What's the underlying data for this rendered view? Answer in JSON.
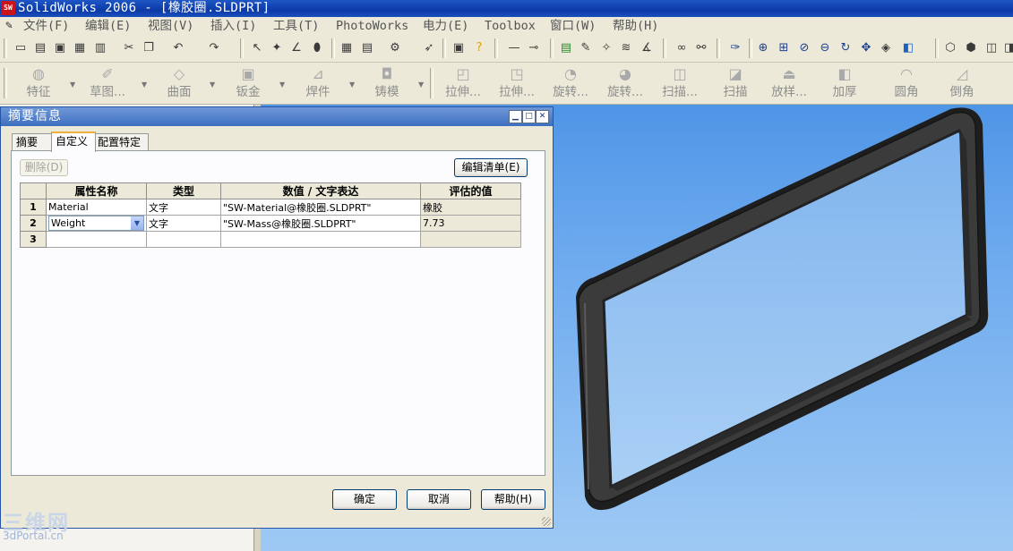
{
  "window": {
    "title": "SolidWorks 2006 - [橡胶圈.SLDPRT]",
    "app_icon": "solidworks-logo-icon"
  },
  "menu": {
    "items": [
      "文件(F)",
      "编辑(E)",
      "视图(V)",
      "插入(I)",
      "工具(T)",
      "PhotoWorks",
      "电力(E)",
      "Toolbox",
      "窗口(W)",
      "帮助(H)"
    ]
  },
  "command_manager": {
    "items": [
      "特征",
      "草图...",
      "曲面",
      "钣金",
      "焊件",
      "铸模",
      "拉伸...",
      "拉伸...",
      "旋转...",
      "旋转...",
      "扫描...",
      "扫描",
      "放样...",
      "加厚",
      "圆角",
      "倒角"
    ]
  },
  "dialog": {
    "title": "摘要信息",
    "tabs": [
      "摘要",
      "自定义",
      "配置特定"
    ],
    "active_tab": "自定义",
    "delete_button": "删除(D)",
    "edit_list_button": "编辑清单(E)",
    "table": {
      "headers": [
        "属性名称",
        "类型",
        "数值 / 文字表达",
        "评估的值"
      ],
      "rows": [
        {
          "num": "1",
          "name": "Material",
          "type": "文字",
          "expression": "\"SW-Material@橡胶圈.SLDPRT\"",
          "value": "橡胶"
        },
        {
          "num": "2",
          "name": "Weight",
          "type": "文字",
          "expression": "\"SW-Mass@橡胶圈.SLDPRT\"",
          "value": "7.73"
        },
        {
          "num": "3",
          "name": "",
          "type": "",
          "expression": "",
          "value": ""
        }
      ]
    },
    "ok_button": "确定",
    "cancel_button": "取消",
    "help_button": "帮助(H)"
  },
  "watermark": {
    "line1": "三维网",
    "line2": "3dPortal.cn"
  },
  "colors": {
    "titlebar": "#0b3aa6",
    "viewport_top": "#4f95e6",
    "viewport_bottom": "#9ec9f4",
    "part": "#2a2a2a"
  }
}
